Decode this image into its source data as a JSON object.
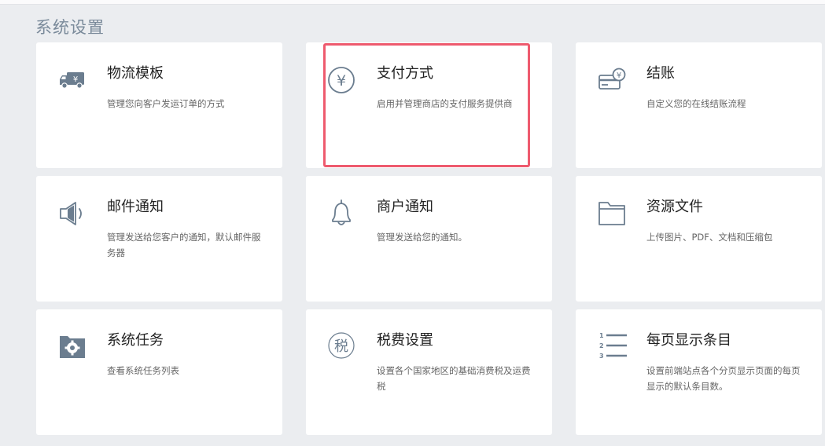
{
  "page": {
    "title": "系统设置"
  },
  "cards": [
    {
      "title": "物流模板",
      "desc": "管理您向客户发运订单的方式",
      "icon": "truck-yen-icon"
    },
    {
      "title": "支付方式",
      "desc": "启用并管理商店的支付服务提供商",
      "icon": "yen-circle-icon"
    },
    {
      "title": "结账",
      "desc": "自定义您的在线结账流程",
      "icon": "card-yen-icon"
    },
    {
      "title": "邮件通知",
      "desc": "管理发送给您客户的通知，默认邮件服务器",
      "icon": "speaker-icon"
    },
    {
      "title": "商户通知",
      "desc": "管理发送给您的通知。",
      "icon": "bell-icon"
    },
    {
      "title": "资源文件",
      "desc": "上传图片、PDF、文档和压缩包",
      "icon": "folder-icon"
    },
    {
      "title": "系统任务",
      "desc": "查看系统任务列表",
      "icon": "gear-folder-icon"
    },
    {
      "title": "税费设置",
      "desc": "设置各个国家地区的基础消费税及运费税",
      "icon": "tax-circle-icon"
    },
    {
      "title": "每页显示条目",
      "desc": "设置前端站点各个分页显示页面的每页显示的默认条目数。",
      "icon": "numbered-list-icon"
    }
  ],
  "icon_glyphs": {
    "yen": "¥",
    "tax": "税",
    "list_numbers": [
      "1",
      "2",
      "3"
    ]
  },
  "colors": {
    "background": "#ebedf0",
    "card": "#ffffff",
    "icon": "#6b7d8f",
    "highlight": "#ee5a6e"
  }
}
